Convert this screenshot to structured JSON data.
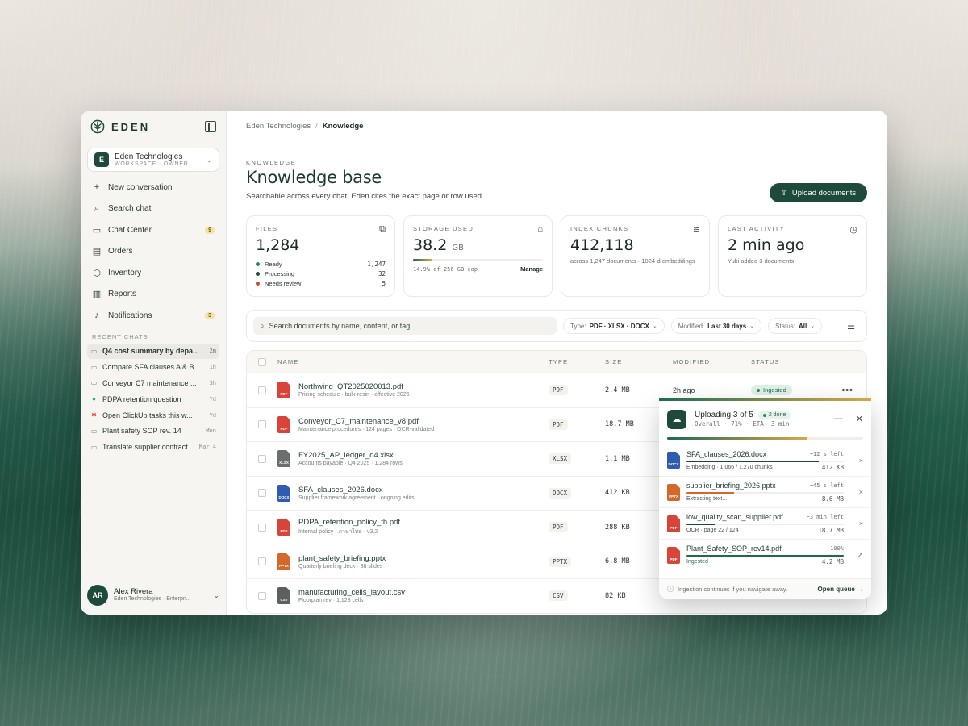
{
  "sidebar": {
    "brand": "EDEN",
    "workspace": {
      "initial": "E",
      "name": "Eden Technologies",
      "role": "WORKSPACE · OWNER"
    },
    "nav": [
      {
        "label": "New conversation",
        "icon": "plus-icon",
        "glyph": "+"
      },
      {
        "label": "Search chat",
        "icon": "search-icon",
        "glyph": "⌕"
      },
      {
        "label": "Chat Center",
        "icon": "inbox-icon",
        "glyph": "▭",
        "badge": "9"
      },
      {
        "label": "Orders",
        "icon": "receipt-icon",
        "glyph": "▤"
      },
      {
        "label": "Inventory",
        "icon": "box-icon",
        "glyph": "⬡"
      },
      {
        "label": "Reports",
        "icon": "bar-chart-icon",
        "glyph": "▥"
      },
      {
        "label": "Notifications",
        "icon": "bell-icon",
        "glyph": "♪",
        "badge": "3"
      }
    ],
    "recent_label": "RECENT CHATS",
    "recent": [
      {
        "title": "Q4 cost summary by depa...",
        "time": "2m",
        "icon": "chat-bubble-icon",
        "glyph": "▭",
        "active": true
      },
      {
        "title": "Compare SFA clauses A & B",
        "time": "1h",
        "icon": "chat-bubble-icon",
        "glyph": "▭"
      },
      {
        "title": "Conveyor C7 maintenance ...",
        "time": "3h",
        "icon": "chat-bubble-icon",
        "glyph": "▭"
      },
      {
        "title": "PDPA retention question",
        "time": "Yd",
        "icon": "line-app-icon",
        "glyph": "●",
        "color": "#22b14c"
      },
      {
        "title": "Open ClickUp tasks this w...",
        "time": "Yd",
        "icon": "slack-icon",
        "glyph": "✱",
        "color": "#d9443a"
      },
      {
        "title": "Plant safety SOP rev. 14",
        "time": "Mon",
        "icon": "chat-bubble-icon",
        "glyph": "▭"
      },
      {
        "title": "Translate supplier contract",
        "time": "Mar 4",
        "icon": "chat-bubble-icon",
        "glyph": "▭"
      }
    ],
    "user": {
      "initials": "AR",
      "name": "Alex Rivera",
      "org": "Eden Technologies · Enterpri..."
    }
  },
  "breadcrumb": {
    "parent": "Eden Technologies",
    "current": "Knowledge"
  },
  "header": {
    "eyebrow": "KNOWLEDGE",
    "title": "Knowledge base",
    "subtitle": "Searchable across every chat. Eden cites the exact page or row used.",
    "upload_label": "Upload documents"
  },
  "stats": {
    "files": {
      "label": "FILES",
      "value": "1,284",
      "breakdown": [
        {
          "label": "Ready",
          "value": "1,247",
          "color": "#2a8a5c"
        },
        {
          "label": "Processing",
          "value": "32",
          "color": "#1d4a3a"
        },
        {
          "label": "Needs review",
          "value": "5",
          "color": "#c4502d"
        }
      ]
    },
    "storage": {
      "label": "STORAGE USED",
      "value": "38.2",
      "unit": "GB",
      "percent": 14.9,
      "cap": "14.9% of 256 GB cap",
      "manage": "Manage"
    },
    "chunks": {
      "label": "INDEX CHUNKS",
      "value": "412,118",
      "desc": "across 1,247 documents · 1024-d embeddings"
    },
    "activity": {
      "label": "LAST ACTIVITY",
      "value": "2 min ago",
      "desc": "Yuki added 3 documents"
    }
  },
  "filters": {
    "search_placeholder": "Search documents by name, content, or tag",
    "type": {
      "label": "Type:",
      "value": "PDF · XLSX · DOCX"
    },
    "modified": {
      "label": "Modified:",
      "value": "Last 30 days"
    },
    "status": {
      "label": "Status:",
      "value": "All"
    }
  },
  "table": {
    "columns": [
      "NAME",
      "TYPE",
      "SIZE",
      "MODIFIED",
      "STATUS"
    ],
    "rows": [
      {
        "name": "Northwind_QT2025020013.pdf",
        "meta": "Pricing schedule · bulk-resin · effective 2026",
        "type": "PDF",
        "size": "2.4 MB",
        "modified": "2h ago",
        "status": "Ingested",
        "kind": "PDF",
        "color": "#d9443a"
      },
      {
        "name": "Conveyor_C7_maintenance_v8.pdf",
        "meta": "Maintenance procedures · 124 pages · OCR-validated",
        "type": "PDF",
        "size": "18.7 MB",
        "modified": "",
        "status": "",
        "kind": "PDF",
        "color": "#d9443a"
      },
      {
        "name": "FY2025_AP_ledger_q4.xlsx",
        "meta": "Accounts payable · Q4 2025 · 1,284 rows",
        "type": "XLSX",
        "size": "1.1 MB",
        "modified": "",
        "status": "",
        "kind": "XLSX",
        "color": "#6b6e6c"
      },
      {
        "name": "SFA_clauses_2026.docx",
        "meta": "Supplier framework agreement · ongoing edits",
        "type": "DOCX",
        "size": "412 KB",
        "modified": "",
        "status": "",
        "kind": "DOCX",
        "color": "#2f5bb0"
      },
      {
        "name": "PDPA_retention_policy_th.pdf",
        "meta": "Internal policy · ภาษาไทย · v3.2",
        "type": "PDF",
        "size": "288 KB",
        "modified": "",
        "status": "",
        "kind": "PDF",
        "color": "#d9443a"
      },
      {
        "name": "plant_safety_briefing.pptx",
        "meta": "Quarterly briefing deck · 38 slides",
        "type": "PPTX",
        "size": "6.8 MB",
        "modified": "",
        "status": "",
        "kind": "PPTX",
        "color": "#d2692a"
      },
      {
        "name": "manufacturing_cells_layout.csv",
        "meta": "Floorplan rev · 1,128 cells",
        "type": "CSV",
        "size": "82 KB",
        "modified": "",
        "status": "",
        "kind": "CSV",
        "color": "#5c605e"
      }
    ]
  },
  "upload_panel": {
    "title": "Uploading 3 of 5",
    "done": "2 done",
    "sub": "Overall · 71% · ETA ~3 min",
    "overall_percent": 71,
    "items": [
      {
        "name": "SFA_clauses_2026.docx",
        "eta": "~12 s left",
        "detail": "Embedding · 1,066 / 1,270 chunks",
        "size": "412 KB",
        "percent": 84,
        "kind": "DOCX",
        "color": "#2f5bb0",
        "bar": "#1d4a3a",
        "action": "×"
      },
      {
        "name": "supplier_briefing_2026.pptx",
        "eta": "~45 s left",
        "detail": "Extracting text...",
        "size": "8.6 MB",
        "percent": 30,
        "kind": "PPTX",
        "color": "#d2692a",
        "bar": "#d2692a",
        "action": "×"
      },
      {
        "name": "low_quality_scan_supplier.pdf",
        "eta": "~3 min left",
        "detail": "OCR · page 22 / 124",
        "size": "18.7 MB",
        "percent": 18,
        "kind": "PDF",
        "color": "#d9443a",
        "bar": "#1d4a3a",
        "action": "×"
      },
      {
        "name": "Plant_Safety_SOP_rev14.pdf",
        "eta": "100%",
        "detail": "Ingested",
        "size": "4.2 MB",
        "percent": 100,
        "kind": "PDF",
        "color": "#d9443a",
        "bar": "#1d6b4a",
        "action": "↗"
      }
    ],
    "footer": "Ingestion continues if you navigate away.",
    "open_queue": "Open queue →"
  }
}
